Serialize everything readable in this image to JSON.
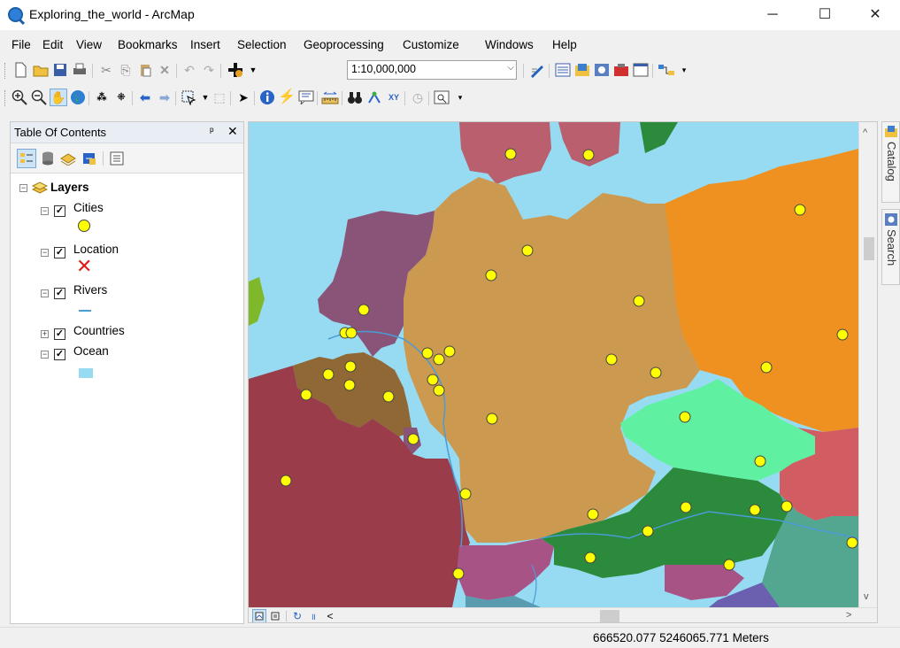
{
  "window": {
    "title": "Exploring_the_world - ArcMap",
    "minimize": "─",
    "maximize": "☐",
    "close": "✕"
  },
  "menu": [
    "File",
    "Edit",
    "View",
    "Bookmarks",
    "Insert",
    "Selection",
    "Geoprocessing",
    "Customize",
    "Windows",
    "Help"
  ],
  "toolbar": {
    "scale": "1:10,000,000",
    "scale_dropdown": "⌵"
  },
  "toc": {
    "title": "Table Of Contents",
    "pin": "ᵖ",
    "close": "✕",
    "root": "Layers",
    "layers": [
      {
        "name": "Cities",
        "checked": true,
        "expanded": true
      },
      {
        "name": "Location",
        "checked": true,
        "expanded": true
      },
      {
        "name": "Rivers",
        "checked": true,
        "expanded": true
      },
      {
        "name": "Countries",
        "checked": true,
        "expanded": false
      },
      {
        "name": "Ocean",
        "checked": true,
        "expanded": true
      }
    ],
    "expand_minus": "−",
    "expand_plus": "+",
    "check": "✓"
  },
  "colors": {
    "ocean": "#97dbf2",
    "germany": "#cc9950",
    "france": "#9a3c4a",
    "poland": "#ef9120",
    "czechia": "#5ff0a2",
    "austria": "#2b8a3c",
    "belgium": "#8f6836",
    "netherlands": "#8a5478",
    "denmark": "#b95f6d",
    "switzerland": "#a85386",
    "slovakia": "#d15c62",
    "hungary": "#53a68f",
    "city": "#ffff00",
    "river": "#4a9bd6"
  },
  "side_tabs": {
    "catalog": "Catalog",
    "search": "Search"
  },
  "map_controls": {
    "scroll_left": "<",
    "scroll_right": ">",
    "scroll_up": "^",
    "scroll_down": "v",
    "refresh": "↻",
    "pause": "॥"
  },
  "status": {
    "coords": "666520.077  5246065.771 Meters"
  }
}
